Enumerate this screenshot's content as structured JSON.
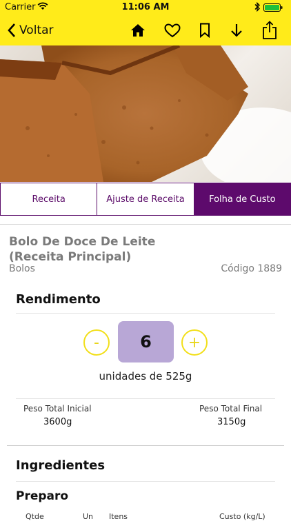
{
  "status": {
    "carrier": "Carrier",
    "time": "11:06 AM"
  },
  "nav": {
    "back_label": "Voltar"
  },
  "tabs": [
    "Receita",
    "Ajuste de Receita",
    "Folha de Custo"
  ],
  "recipe": {
    "title_line1": "Bolo De Doce De Leite",
    "title_line2": "(Receita Principal)",
    "category": "Bolos",
    "code": "Código 1889"
  },
  "yield": {
    "heading": "Rendimento",
    "minus": "-",
    "plus": "+",
    "quantity": "6",
    "units_text": "unidades de 525g",
    "weight_initial_label": "Peso Total Inicial",
    "weight_initial_value": "3600g",
    "weight_final_label": "Peso Total Final",
    "weight_final_value": "3150g"
  },
  "sections": {
    "ingredients": "Ingredientes",
    "preparation": "Preparo"
  },
  "table_headers": [
    "Qtde",
    "Un",
    "Itens",
    "Custo (kg/L)"
  ],
  "colors": {
    "accent_yellow": "#FFEB1A",
    "purple": "#5d0a6c",
    "qty_bg": "#b8a7d6"
  }
}
